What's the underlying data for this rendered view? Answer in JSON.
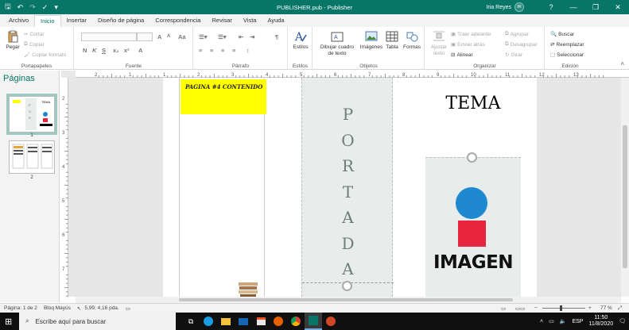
{
  "window": {
    "title": "PUBLISHER.pub  -  Publisher",
    "user_name": "Iria Reyes",
    "user_initials": "IR",
    "help": "?",
    "minimize": "—",
    "maximize": "❐",
    "close": "✕"
  },
  "tabs": [
    "Archivo",
    "Inicio",
    "Insertar",
    "Diseño de página",
    "Correspondencia",
    "Revisar",
    "Vista",
    "Ayuda"
  ],
  "ribbon": {
    "portapapeles": {
      "label": "Portapapeles",
      "paste": "Pegar",
      "cut": "Cortar",
      "copy": "Copiar",
      "format_painter": "Copiar formato"
    },
    "fuente": {
      "label": "Fuente",
      "bold": "N",
      "italic": "K",
      "underline": "S",
      "sub": "x₂",
      "sup": "x²",
      "case": "Aa",
      "color_a": "A",
      "grow": "A",
      "shrink": "A"
    },
    "parrafo": {
      "label": "Párrafo",
      "pilcrow": "¶"
    },
    "estilos": {
      "label": "Estilos",
      "styles": "Estilos"
    },
    "objetos": {
      "label": "Objetos",
      "textbox_line1": "Dibujar cuadro",
      "textbox_line2": "de texto",
      "images": "Imágenes",
      "table": "Tabla",
      "shapes": "Formas"
    },
    "organizar": {
      "label": "Organizar",
      "wrap_line1": "Ajustar",
      "wrap_line2": "texto",
      "bring_forward": "Traer adelante",
      "send_back": "Enviar atrás",
      "align": "Alinear",
      "group": "Agrupar",
      "ungroup": "Desagrupar",
      "rotate": "Girar"
    },
    "edicion": {
      "label": "Edición",
      "find": "Buscar",
      "replace": "Reemplazar",
      "select": "Seleccionar"
    }
  },
  "pages_pane": {
    "title": "Páginas",
    "thumb1_num": "1",
    "thumb2_num": "2"
  },
  "ruler_h_numbers": [
    "2",
    "1",
    "1",
    "2",
    "3",
    "4",
    "5",
    "6",
    "7",
    "8",
    "9",
    "10",
    "11",
    "12",
    "13"
  ],
  "ruler_v_numbers": [
    "2",
    "3",
    "4",
    "5",
    "6",
    "7",
    "8"
  ],
  "document": {
    "panel_label": "PAGINA #4 CONTENIDO",
    "portada_letters": [
      "P",
      "O",
      "R",
      "T",
      "A",
      "D",
      "A"
    ],
    "tema": "TEMA",
    "imagen": "IMAGEN",
    "colors": {
      "yellow": "#ffff00",
      "blue": "#1e88d0",
      "red": "#e8253f",
      "panel_gray": "#e8eceb"
    }
  },
  "status": {
    "page": "Página: 1 de 2",
    "caps": "Bloq Mayús",
    "position": "5,99; 4,16 pda.",
    "zoom": "77 %"
  },
  "taskbar": {
    "search_placeholder": "Escribe aquí para buscar",
    "time": "11:50",
    "date": "11/8/2020",
    "lang": "ESP"
  }
}
